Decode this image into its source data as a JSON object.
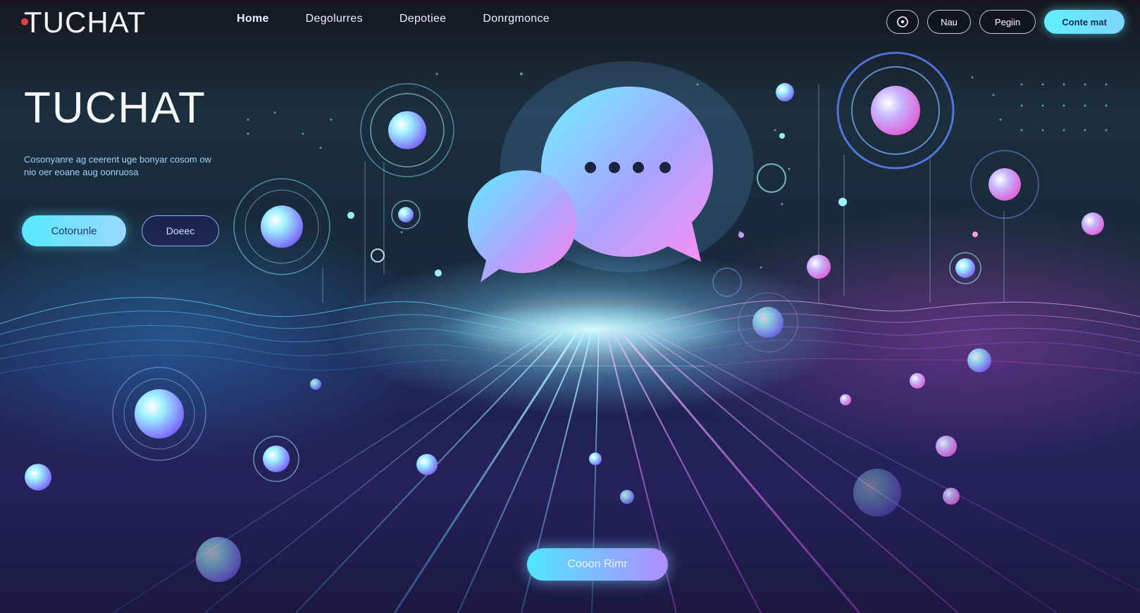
{
  "header": {
    "logo": "TUCHAT",
    "nav": [
      {
        "label": "Home",
        "active": true
      },
      {
        "label": "Degolurres"
      },
      {
        "label": "Depotiee"
      },
      {
        "label": "Donrgmonce"
      }
    ],
    "actions": {
      "icon": "circle-icon",
      "small_label": "Nau",
      "register_label": "Pegiin",
      "primary_label": "Conte mat"
    }
  },
  "hero": {
    "title": "TUCHAT",
    "description": "Cosonyanre ag ceerent uge bonyar cosom ow nio oer eoane aug oonruosa",
    "primary_cta": "Cotorunle",
    "secondary_cta": "Doeec"
  },
  "bottom_cta": "Cooon Rimr",
  "illustration": {
    "chat_bubble_icon": "chat-bubbles-icon",
    "typing_indicator": "typing-dots-icon"
  },
  "colors": {
    "accent_cyan": "#56e8ff",
    "accent_purple": "#b08cff",
    "accent_pink": "#ff6ad8",
    "background": "#17283a"
  }
}
